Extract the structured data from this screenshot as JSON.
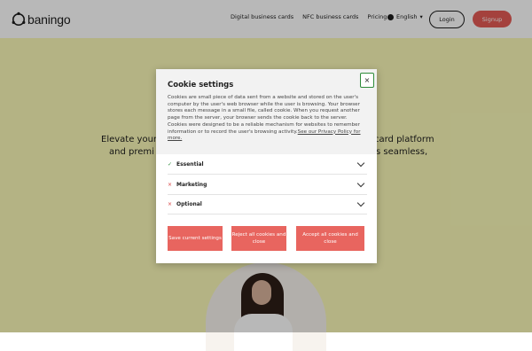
{
  "brand": {
    "logo_text": "baningo"
  },
  "nav": {
    "links": [
      "Digital business cards",
      "NFC business cards",
      "Pricing"
    ],
    "language": "English",
    "login_label": "Login",
    "signup_label": "Signup"
  },
  "hero": {
    "line1_left": "Elevate your",
    "line1_right": "card platform",
    "line2_left": "and premi",
    "line2_right": "s seamless,"
  },
  "cookie_modal": {
    "title": "Cookie settings",
    "description": "Cookies are small piece of data sent from a website and stored on the user's computer by the user's web browser while the user is browsing. Your browser stores each message in a small file, called cookie. When you request another page from the server, your browser sends the cookie back to the server. Cookies were designed to be a reliable mechanism for websites to remember information or to record the user's browsing activity.",
    "privacy_link": "See our Privacy Policy for more.",
    "close_symbol": "×",
    "categories": [
      {
        "label": "Essential",
        "mark": "✓",
        "enabled": true
      },
      {
        "label": "Marketing",
        "mark": "×",
        "enabled": false
      },
      {
        "label": "Optional",
        "mark": "×",
        "enabled": false
      }
    ],
    "buttons": {
      "save": "Save current settings",
      "reject": "Reject all cookies and close",
      "accept": "Accept all cookies and close"
    }
  },
  "colors": {
    "accent": "#e8655f",
    "hero_bg": "#faf9b8",
    "check_green": "#2e8b3a",
    "cross_red": "#d63c3c"
  }
}
